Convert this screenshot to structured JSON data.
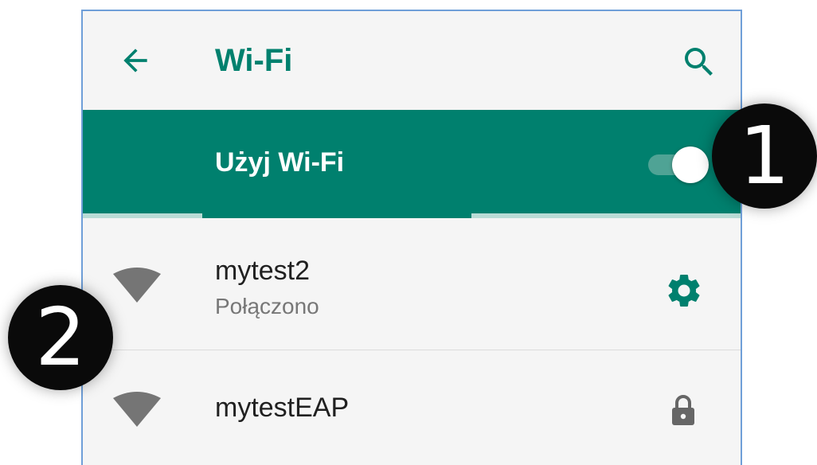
{
  "header": {
    "title": "Wi-Fi",
    "back_icon": "arrow-left-icon",
    "search_icon": "search-icon"
  },
  "master_switch": {
    "label": "Użyj Wi-Fi",
    "state": "on"
  },
  "networks": [
    {
      "name": "mytest2",
      "status": "Połączono",
      "icon": "wifi-signal-icon",
      "action_icon": "gear-icon"
    },
    {
      "name": "mytestEAP",
      "status": "",
      "icon": "wifi-signal-icon",
      "action_icon": "lock-icon"
    }
  ],
  "callouts": [
    {
      "label": "1"
    },
    {
      "label": "2"
    }
  ],
  "colors": {
    "accent": "#00806e",
    "background": "#f5f5f5",
    "text": "#202020",
    "secondary_text": "#777777",
    "callout": "#0a0a0a"
  }
}
